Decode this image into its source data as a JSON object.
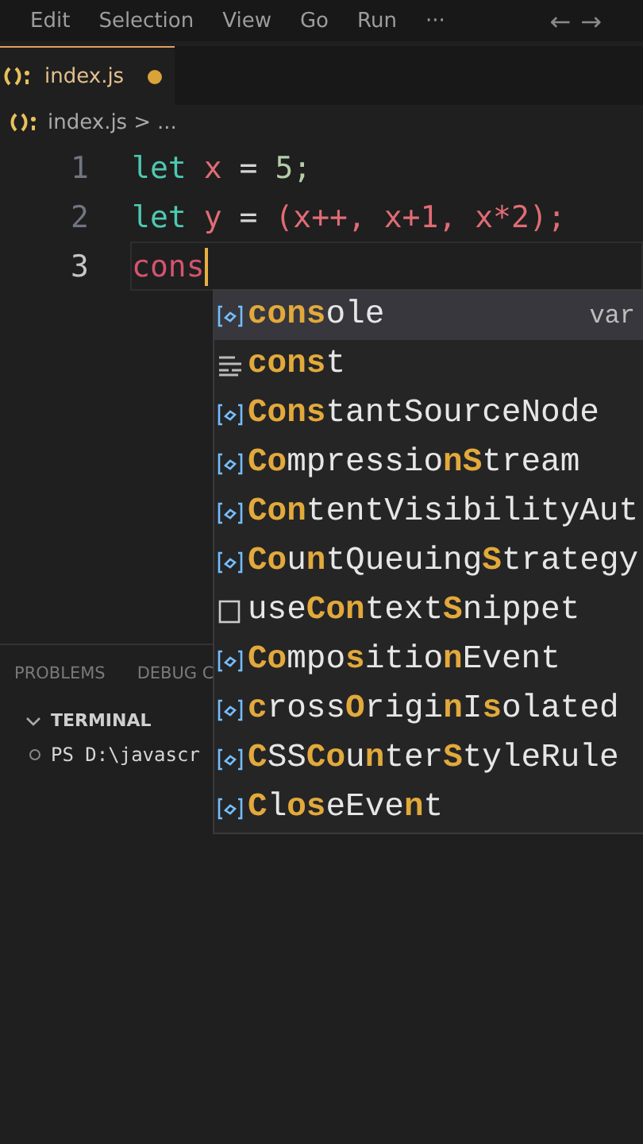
{
  "menu_bar": {
    "items": [
      "Edit",
      "Selection",
      "View",
      "Go",
      "Run",
      "···"
    ],
    "nav": [
      "←",
      "→"
    ]
  },
  "tabs": [
    {
      "label": "index.js",
      "selected": true,
      "modified": true
    }
  ],
  "breadcrumb": {
    "file": "index.js",
    "separator": ">",
    "tail": "..."
  },
  "editor": {
    "lines": [
      {
        "number": "1",
        "current": false,
        "tokens": [
          {
            "kind": "keyword",
            "text": "let"
          },
          {
            "kind": "variable",
            "text": "x"
          },
          {
            "kind": "operator",
            "text": "="
          },
          {
            "kind": "number",
            "text": "5;"
          }
        ]
      },
      {
        "number": "2",
        "current": false,
        "tokens": [
          {
            "kind": "keyword",
            "text": "let"
          },
          {
            "kind": "variable",
            "text": "y"
          },
          {
            "kind": "operator",
            "text": "="
          },
          {
            "kind": "punct",
            "text": "(x++, x+1, x*2);"
          }
        ]
      },
      {
        "number": "3",
        "current": true,
        "tokens": [
          {
            "kind": "typed",
            "text": "cons"
          }
        ]
      }
    ]
  },
  "suggestions": [
    {
      "kind": "variable",
      "label": "**cons**ole",
      "selected": true,
      "detail": "var"
    },
    {
      "kind": "keyword",
      "label": "**cons**t",
      "selected": false
    },
    {
      "kind": "variable",
      "label": "**Cons**tantSourceNode",
      "selected": false
    },
    {
      "kind": "variable",
      "label": "**Co**mpressio**nS**tream",
      "selected": false
    },
    {
      "kind": "variable",
      "label": "**Con**tentVisibilityAut",
      "selected": false
    },
    {
      "kind": "variable",
      "label": "**Co**u**n**tQueuing**S**trategy",
      "selected": false
    },
    {
      "kind": "snippet",
      "label": "use**Con**text**S**nippet",
      "selected": false
    },
    {
      "kind": "variable",
      "label": "**Co**mpo**s**itio**n**Event",
      "selected": false
    },
    {
      "kind": "variable",
      "label": "**c**ross**O**rigi**n**I**s**olated",
      "selected": false
    },
    {
      "kind": "variable",
      "label": "**C**SS**Co**u**n**ter**S**tyleRule",
      "selected": false
    },
    {
      "kind": "variable",
      "label": "**C**l**os**eEve**n**t",
      "selected": false
    }
  ],
  "panel": {
    "tabs": [
      "PROBLEMS",
      "DEBUG C"
    ],
    "section": {
      "title": "TERMINAL",
      "expanded": true
    },
    "terminal_line": "PS D:\\javascr"
  }
}
